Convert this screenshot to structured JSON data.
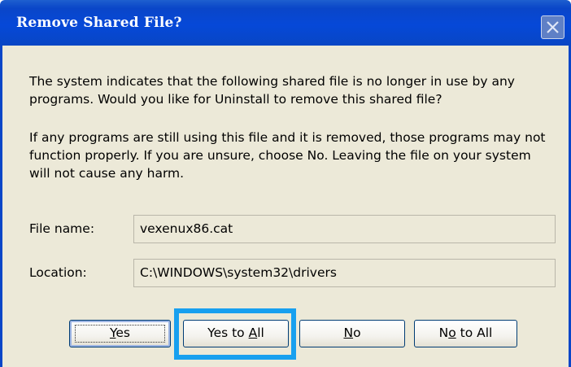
{
  "window": {
    "title": "Remove Shared File?"
  },
  "message": {
    "paragraph1": "The system indicates that the following shared file is no longer in use by any programs. Would you like for Uninstall to remove this shared file?",
    "paragraph2": "If any programs are still using this file and it is removed, those programs may not function properly. If you are unsure, choose No. Leaving the file on your system will not cause any harm."
  },
  "fields": {
    "file_name_label": "File name:",
    "file_name_value": "vexenux86.cat",
    "location_label": "Location:",
    "location_value": "C:\\WINDOWS\\system32\\drivers"
  },
  "buttons": {
    "yes": {
      "pre": "",
      "key": "Y",
      "post": "es"
    },
    "yes_to_all": {
      "pre": "Yes to ",
      "key": "A",
      "post": "ll"
    },
    "no": {
      "pre": "",
      "key": "N",
      "post": "o"
    },
    "no_to_all": {
      "pre": "N",
      "key": "o",
      "post": " to All"
    }
  },
  "colors": {
    "titlebar": "#0a46c8",
    "dialog_bg": "#ece9d8",
    "highlight": "#18a0ef"
  }
}
